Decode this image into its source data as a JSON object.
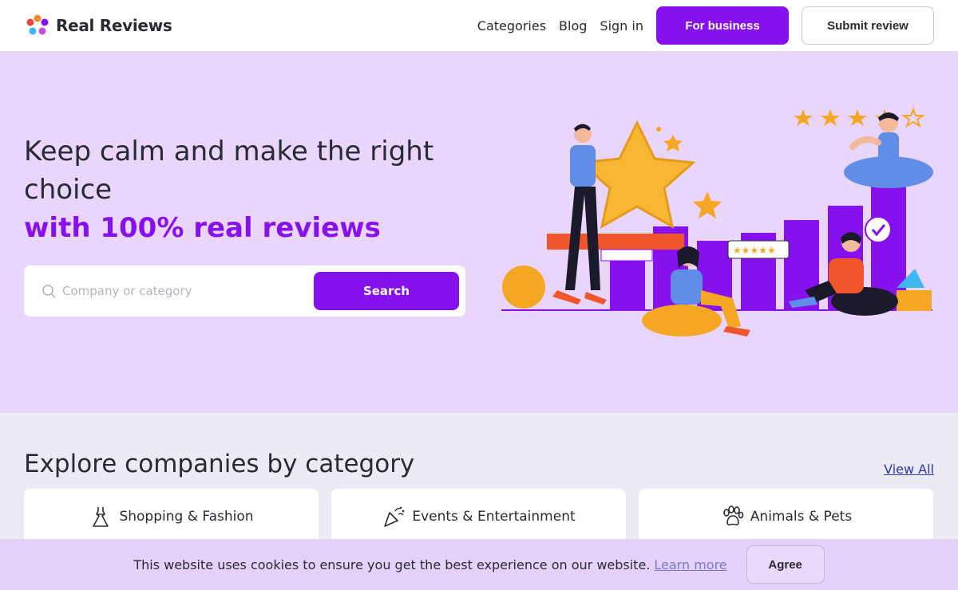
{
  "header": {
    "logo_text": "Real Reviews",
    "nav": [
      {
        "label": "Categories"
      },
      {
        "label": "Blog"
      },
      {
        "label": "Sign in"
      }
    ],
    "business_button": "For business",
    "submit_button": "Submit review"
  },
  "hero": {
    "title_line": "Keep calm and make the right choice",
    "title_accent": "with 100% real reviews",
    "search": {
      "placeholder": "Company or category",
      "value": "",
      "button": "Search"
    }
  },
  "categories": {
    "title": "Explore companies by category",
    "view_all": "View All",
    "items": [
      {
        "label": "Shopping & Fashion",
        "icon": "dress-icon"
      },
      {
        "label": "Events & Entertainment",
        "icon": "party-popper-icon"
      },
      {
        "label": "Animals & Pets",
        "icon": "paw-icon"
      }
    ]
  },
  "cookie": {
    "text": "This website uses cookies to ensure you get the best experience on our website.",
    "link": "Learn more",
    "agree": "Agree"
  },
  "colors": {
    "brand": "#8711ee",
    "hero_bg": "#ead6fc",
    "section_bg": "#ecebf5",
    "cookie_bg": "#e5d1fa",
    "link": "#2a35b5"
  }
}
